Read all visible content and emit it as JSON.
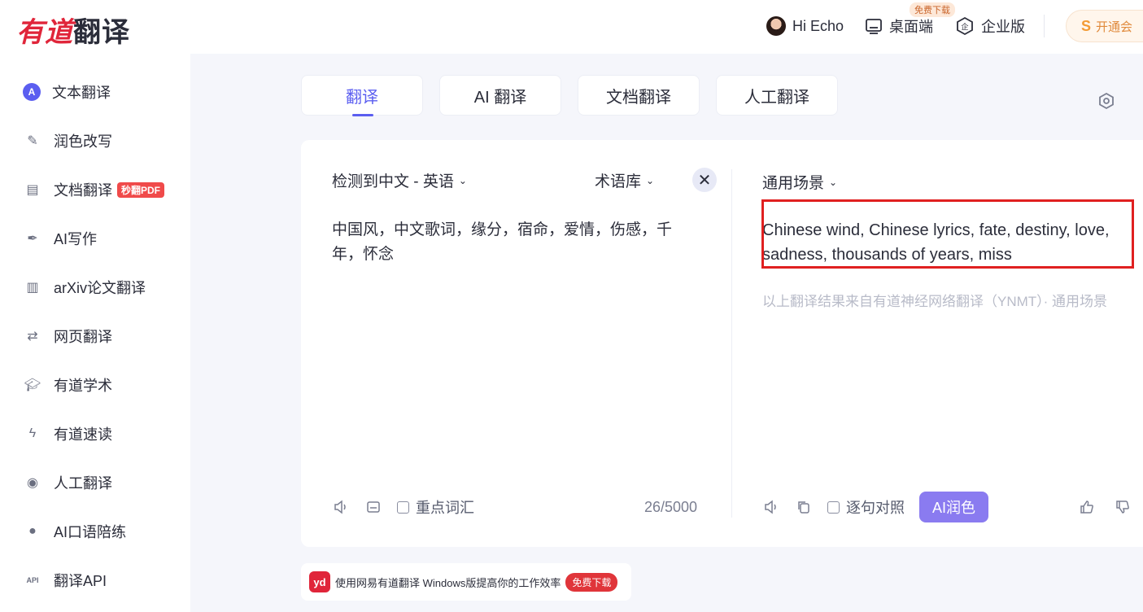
{
  "header": {
    "logo_red": "有道",
    "logo_dark": "翻译",
    "greeting": "Hi Echo",
    "desktop_label": "桌面端",
    "free_download_tag": "免费下载",
    "enterprise_label": "企业版",
    "vip_label": "开通会"
  },
  "sidebar": {
    "items": [
      {
        "label": "文本翻译",
        "icon": "text-translate-icon"
      },
      {
        "label": "润色改写",
        "icon": "magic-wand-icon"
      },
      {
        "label": "文档翻译",
        "icon": "document-icon",
        "badge": "秒翻PDF"
      },
      {
        "label": "AI写作",
        "icon": "pen-icon"
      },
      {
        "label": "arXiv论文翻译",
        "icon": "books-icon"
      },
      {
        "label": "网页翻译",
        "icon": "webpage-icon"
      },
      {
        "label": "有道学术",
        "icon": "graduation-cap-icon"
      },
      {
        "label": "有道速读",
        "icon": "lightning-icon"
      },
      {
        "label": "人工翻译",
        "icon": "headset-icon"
      },
      {
        "label": "AI口语陪练",
        "icon": "person-icon"
      },
      {
        "label": "翻译API",
        "icon": "api-icon"
      }
    ]
  },
  "tabs": [
    {
      "label": "翻译"
    },
    {
      "label": "AI 翻译"
    },
    {
      "label": "文档翻译"
    },
    {
      "label": "人工翻译"
    }
  ],
  "source": {
    "language_label": "检测到中文 - 英语",
    "glossary_label": "术语库",
    "text": "中国风，中文歌词，缘分，宿命，爱情，伤感，千年，怀念",
    "key_vocab_label": "重点词汇",
    "counter": "26/5000"
  },
  "target": {
    "scene_label": "通用场景",
    "text": "Chinese wind, Chinese lyrics, fate, destiny, love, sadness, thousands of years, miss",
    "source_note": "以上翻译结果来自有道神经网络翻译（YNMT）· 通用场景",
    "sentence_compare_label": "逐句对照",
    "ai_polish_label": "AI润色"
  },
  "promo": {
    "icon_text": "yd",
    "text": "使用网易有道翻译 Windows版提高你的工作效率",
    "button": "免费下载"
  },
  "colors": {
    "accent": "#5b5ef0",
    "brand_red": "#e0253a",
    "highlight_border": "#e02020",
    "ai_button": "#8a7bf0"
  }
}
